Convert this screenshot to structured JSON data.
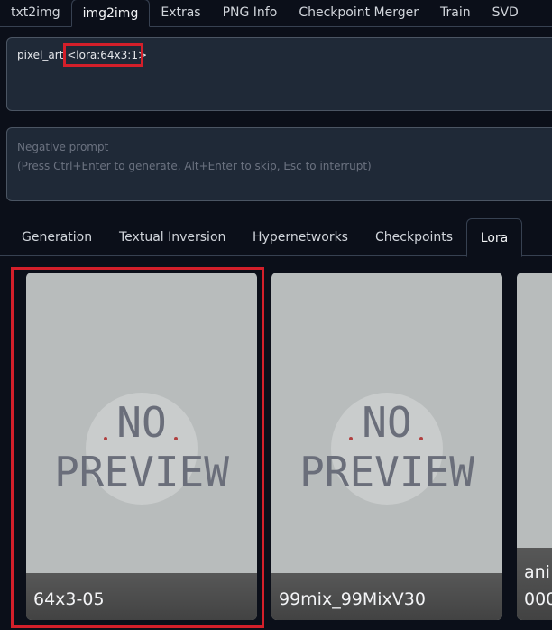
{
  "top_tabs": [
    {
      "label": "txt2img"
    },
    {
      "label": "img2img"
    },
    {
      "label": "Extras"
    },
    {
      "label": "PNG Info"
    },
    {
      "label": "Checkpoint Merger"
    },
    {
      "label": "Train"
    },
    {
      "label": "SVD"
    }
  ],
  "prompt": {
    "text_before": "pixel_art ",
    "lora_tag": "<lora:64x3:1>"
  },
  "negative_prompt": {
    "placeholder_line1": "Negative prompt",
    "placeholder_line2": "(Press Ctrl+Enter to generate, Alt+Enter to skip, Esc to interrupt)"
  },
  "sub_tabs": [
    {
      "label": "Generation"
    },
    {
      "label": "Textual Inversion"
    },
    {
      "label": "Hypernetworks"
    },
    {
      "label": "Checkpoints"
    },
    {
      "label": "Lora"
    }
  ],
  "cards": [
    {
      "name": "64x3-05",
      "preview_line1": "NO",
      "preview_line2": "PREVIEW"
    },
    {
      "name": "99mix_99MixV30",
      "preview_line1": "NO",
      "preview_line2": "PREVIEW"
    },
    {
      "name_line1": "ani",
      "name_line2": "000"
    }
  ],
  "colors": {
    "background": "#0b0f19",
    "highlight": "#d41f2a",
    "card": "#b8bcbc"
  }
}
